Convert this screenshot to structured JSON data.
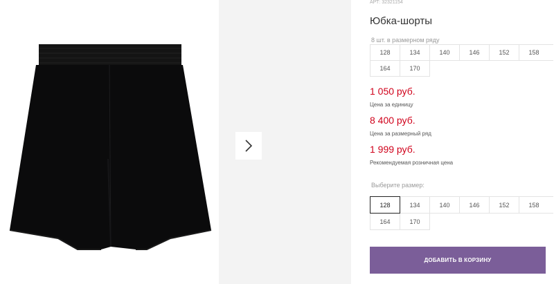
{
  "product": {
    "sku": "АРТ: 32321154",
    "title": "Юбка-шорты",
    "image": "black-skirt-shorts-photo"
  },
  "gallery": {
    "next_icon": "chevron-right-icon"
  },
  "pack": {
    "label": "8 шт. в размерном ряду",
    "sizes": [
      "128",
      "134",
      "140",
      "146",
      "152",
      "158",
      "164",
      "170"
    ]
  },
  "prices": [
    {
      "value": "1 050 руб.",
      "note": "Цена за единицу"
    },
    {
      "value": "8 400 руб.",
      "note": "Цена за размерный ряд"
    },
    {
      "value": "1 999 руб.",
      "note": "Рекомендуемая розничная цена"
    }
  ],
  "size_select": {
    "label": "Выберите размер:",
    "sizes": [
      "128",
      "134",
      "140",
      "146",
      "152",
      "158",
      "164",
      "170"
    ],
    "selected": "128"
  },
  "cart": {
    "button_label": "ДОБАВИТЬ В КОРЗИНУ"
  },
  "colors": {
    "price": "#d0021b",
    "accent_button": "#7b5e99"
  }
}
